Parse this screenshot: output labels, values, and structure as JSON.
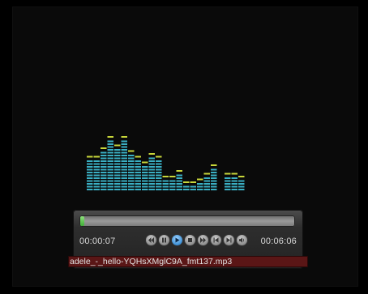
{
  "player": {
    "elapsed": "00:00:07",
    "total": "00:06:06",
    "progress_fraction": 0.019,
    "filename": "adele_-_hello-YQHsXMglC9A_fmt137.mp3",
    "controls": [
      {
        "name": "rewind-icon"
      },
      {
        "name": "pause-icon"
      },
      {
        "name": "play-icon",
        "active": true
      },
      {
        "name": "stop-icon"
      },
      {
        "name": "fast-forward-icon"
      },
      {
        "name": "previous-icon"
      },
      {
        "name": "next-icon"
      },
      {
        "name": "volume-icon"
      }
    ]
  },
  "equalizer": {
    "levels": [
      11,
      11,
      14,
      18,
      15,
      18,
      13,
      11,
      9,
      12,
      11,
      4,
      4,
      6,
      2,
      2,
      3,
      5,
      8,
      0,
      5,
      5,
      4
    ],
    "bar_color": "#3ab0c4",
    "peak_color": "#c8d63a"
  }
}
